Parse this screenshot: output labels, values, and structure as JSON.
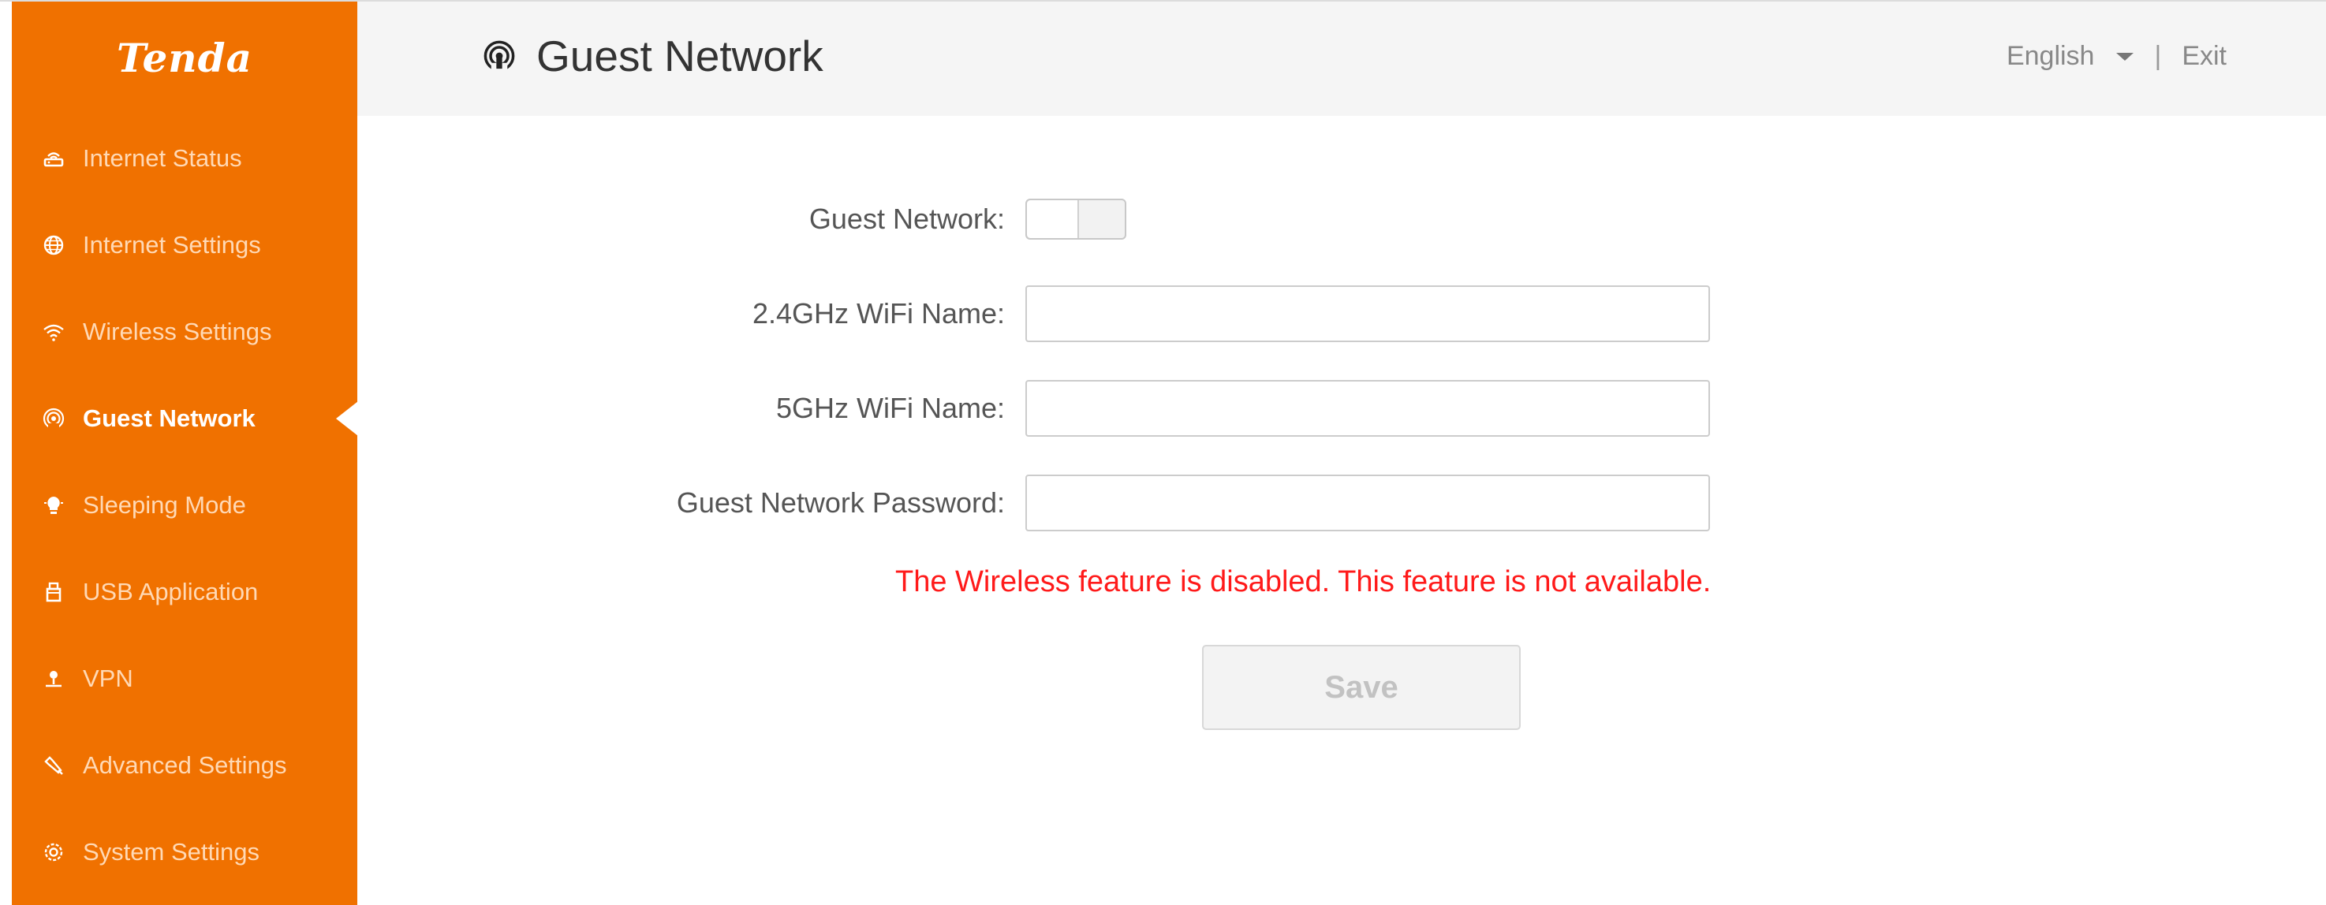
{
  "brand": {
    "logo_text": "Tenda",
    "accent_color": "#f07100"
  },
  "sidebar": {
    "items": [
      {
        "label": "Internet Status",
        "icon": "router-icon",
        "active": false
      },
      {
        "label": "Internet Settings",
        "icon": "globe-icon",
        "active": false
      },
      {
        "label": "Wireless Settings",
        "icon": "wifi-icon",
        "active": false
      },
      {
        "label": "Guest Network",
        "icon": "guest-wifi-icon",
        "active": true
      },
      {
        "label": "Sleeping Mode",
        "icon": "bulb-icon",
        "active": false
      },
      {
        "label": "USB Application",
        "icon": "usb-icon",
        "active": false
      },
      {
        "label": "VPN",
        "icon": "vpn-icon",
        "active": false
      },
      {
        "label": "Advanced Settings",
        "icon": "wrench-icon",
        "active": false
      },
      {
        "label": "System Settings",
        "icon": "gear-icon",
        "active": false
      }
    ]
  },
  "header": {
    "title": "Guest Network",
    "title_icon": "guest-wifi-icon",
    "language": "English",
    "separator": "|",
    "exit_label": "Exit"
  },
  "form": {
    "guest_network_label": "Guest Network:",
    "guest_network_enabled": false,
    "wifi24_label": "2.4GHz WiFi Name:",
    "wifi24_value": "",
    "wifi5_label": "5GHz WiFi Name:",
    "wifi5_value": "",
    "password_label": "Guest Network Password:",
    "password_value": "",
    "error_message": "The Wireless feature is disabled. This feature is not available.",
    "error_color": "#ff1a1a",
    "save_label": "Save"
  }
}
